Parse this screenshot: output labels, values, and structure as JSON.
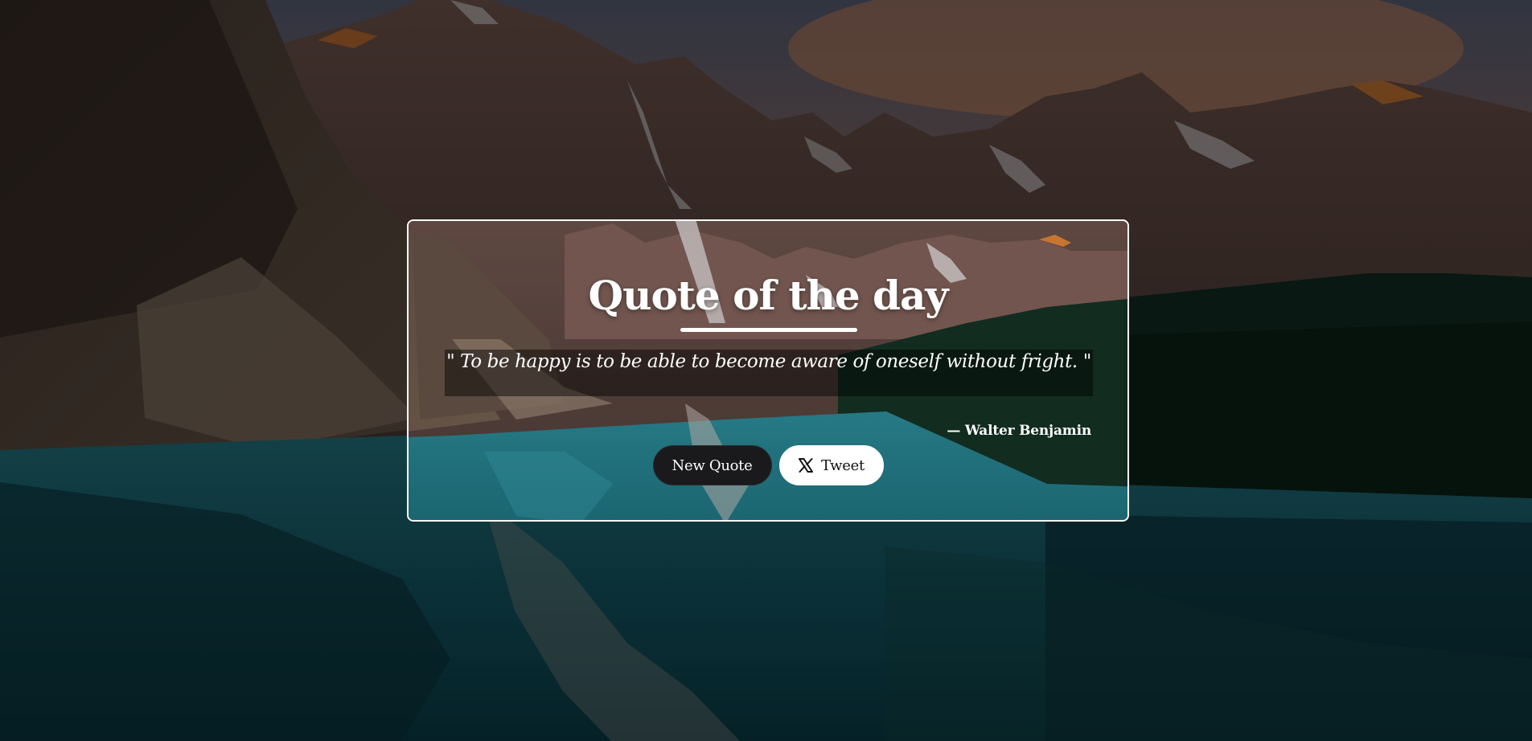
{
  "background": {
    "description_icon": "mountain-lake-landscape",
    "colors": {
      "sky": "#e79a6d",
      "mountain": "#7a5a50",
      "forest": "#173a2a",
      "lake": "#1c7c8c"
    }
  },
  "card": {
    "title": "Quote of the day",
    "quote_text": "\" To be happy is to be able to become aware of oneself without fright. \"",
    "author": "— Walter Benjamin",
    "buttons": {
      "new_quote_label": "New Quote",
      "tweet_label": "Tweet",
      "tweet_icon": "x-logo-icon"
    }
  }
}
